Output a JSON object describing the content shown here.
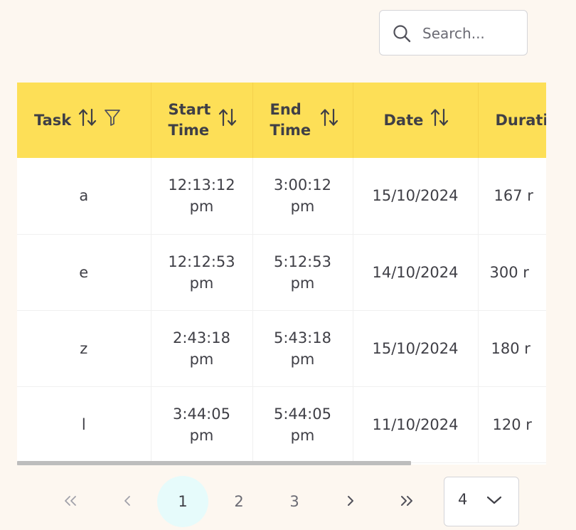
{
  "search": {
    "placeholder": "Search...",
    "icon": "search-icon"
  },
  "table": {
    "columns": [
      {
        "key": "task",
        "label": "Task",
        "sortable": true,
        "filterable": true
      },
      {
        "key": "start",
        "label": "Start Time",
        "sortable": true
      },
      {
        "key": "end",
        "label": "End Time",
        "sortable": true
      },
      {
        "key": "date",
        "label": "Date",
        "sortable": true
      },
      {
        "key": "duration",
        "label": "Durati",
        "sortable": false
      }
    ],
    "rows": [
      {
        "task": "a",
        "start": "12:13:12 pm",
        "end": "3:00:12 pm",
        "date": "15/10/2024",
        "duration": "167 r"
      },
      {
        "task": "e",
        "start": "12:12:53 pm",
        "end": "5:12:53 pm",
        "date": "14/10/2024",
        "duration": "300 r"
      },
      {
        "task": "z",
        "start": "2:43:18 pm",
        "end": "5:43:18 pm",
        "date": "15/10/2024",
        "duration": "180 r"
      },
      {
        "task": "l",
        "start": "3:44:05 pm",
        "end": "5:44:05 pm",
        "date": "11/10/2024",
        "duration": "120 r"
      }
    ],
    "header_color": "#fddf57"
  },
  "pagination": {
    "first": "«",
    "prev": "‹",
    "pages": [
      "1",
      "2",
      "3"
    ],
    "current_page": "1",
    "next": "›",
    "last": "»",
    "rows_per_page": "4"
  },
  "colors": {
    "background": "#fdf7f0",
    "accent": "#fddf57",
    "active_page": "#e6fbfb"
  }
}
